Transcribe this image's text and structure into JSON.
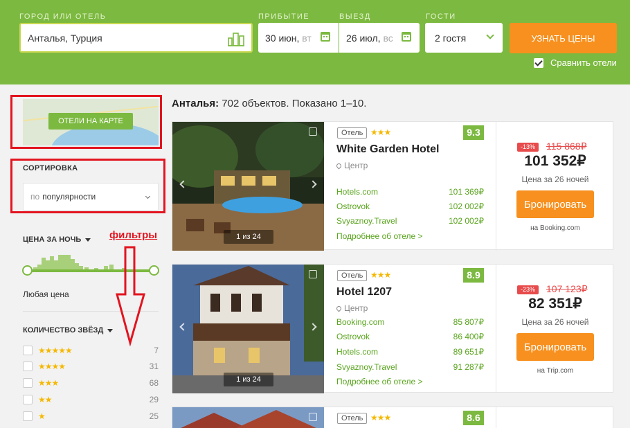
{
  "search": {
    "city_label": "ГОРОД ИЛИ ОТЕЛЬ",
    "city_value": "Анталья, Турция",
    "checkin_label": "ПРИБЫТИЕ",
    "checkin_value": "30 июн,",
    "checkin_weekday": "вт",
    "checkout_label": "ВЫЕЗД",
    "checkout_value": "26 июл,",
    "checkout_weekday": "вс",
    "guests_label": "ГОСТИ",
    "guests_value": "2 гостя",
    "submit_label": "УЗНАТЬ ЦЕНЫ",
    "compare_label": "Сравнить отели",
    "compare_checked": true
  },
  "sidebar": {
    "map_button": "ОТЕЛИ НА КАРТЕ",
    "sort_title": "СОРТИРОВКА",
    "sort_prefix": "по",
    "sort_value": "популярности",
    "price_title": "ЦЕНА ЗА НОЧЬ",
    "filters_annotation": "фильтры",
    "price_value": "Любая цена",
    "stars_title": "КОЛИЧЕСТВО ЗВЁЗД",
    "star_filters": [
      {
        "stars": "★★★★★",
        "count": "7"
      },
      {
        "stars": "★★★★",
        "count": "31"
      },
      {
        "stars": "★★★",
        "count": "68"
      },
      {
        "stars": "★★",
        "count": "29"
      },
      {
        "stars": "★",
        "count": "25"
      }
    ]
  },
  "results": {
    "city": "Анталья:",
    "summary": "702 объектов. Показано 1–10.",
    "hotels": [
      {
        "type": "Отель",
        "stars": "★★★",
        "score": "9.3",
        "name": "White Garden Hotel",
        "location": "Центр",
        "photo_counter": "1 из 24",
        "offers": [
          {
            "site": "Hotels.com",
            "price": "101 369₽"
          },
          {
            "site": "Ostrovok",
            "price": "102 002₽"
          },
          {
            "site": "Svyaznoy.Travel",
            "price": "102 002₽"
          }
        ],
        "more": "Подробнее об отеле >",
        "discount": "-13%",
        "old_price": "115 868₽",
        "price": "101 352₽",
        "nights": "Цена за 26 ночей",
        "book": "Бронировать",
        "site": "на Booking.com"
      },
      {
        "type": "Отель",
        "stars": "★★★",
        "score": "8.9",
        "name": "Hotel 1207",
        "location": "Центр",
        "photo_counter": "1 из 24",
        "offers": [
          {
            "site": "Booking.com",
            "price": "85 807₽"
          },
          {
            "site": "Ostrovok",
            "price": "86 400₽"
          },
          {
            "site": "Hotels.com",
            "price": "89 651₽"
          },
          {
            "site": "Svyaznoy.Travel",
            "price": "91 287₽"
          }
        ],
        "more": "Подробнее об отеле >",
        "discount": "-23%",
        "old_price": "107 123₽",
        "price": "82 351₽",
        "nights": "Цена за 26 ночей",
        "book": "Бронировать",
        "site": "на Trip.com"
      },
      {
        "type": "Отель",
        "stars": "★★★",
        "score": "8.6"
      }
    ]
  },
  "colors": {
    "brand_green": "#7cb940",
    "accent_orange": "#f7901e",
    "annotation_red": "#e2141f",
    "discount_red": "#e84b4b"
  }
}
